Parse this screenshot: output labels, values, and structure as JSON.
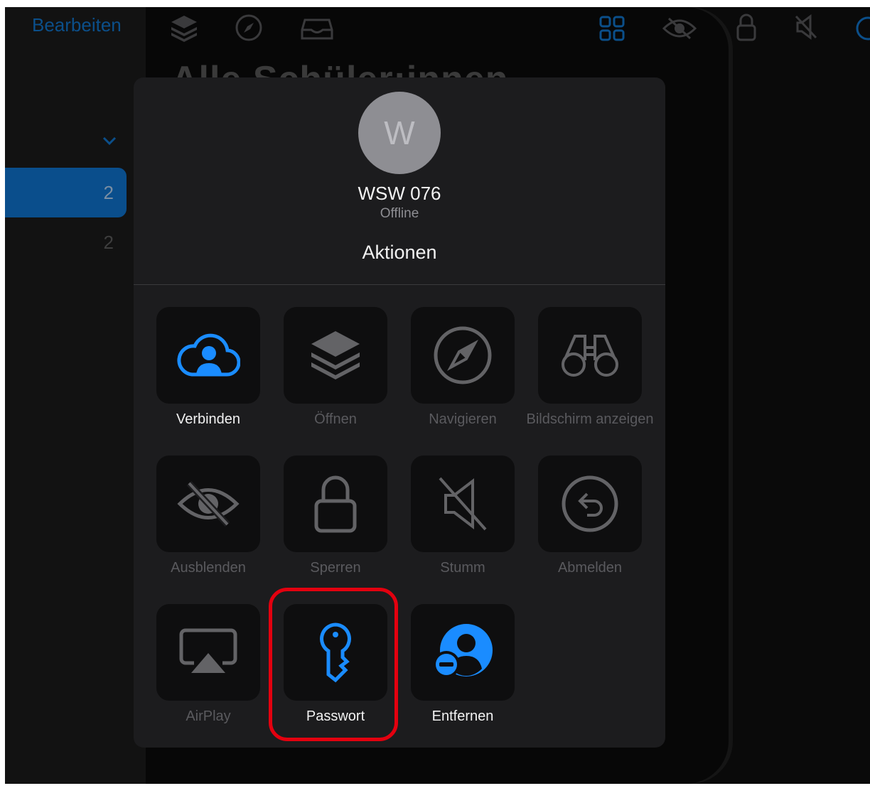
{
  "topbar": {
    "edit_label": "Bearbeiten",
    "icons": [
      "layers-icon",
      "compass-icon",
      "tray-icon",
      "grid-icon",
      "eye-slash-icon",
      "lock-icon",
      "speaker-mute-icon",
      "more-icon"
    ]
  },
  "background": {
    "title": "Alle Schüler:innen",
    "sidebar_counts": [
      "2",
      "2"
    ]
  },
  "popover": {
    "avatar_letter": "W",
    "device_name": "WSW 076",
    "status": "Offline",
    "section_title": "Aktionen",
    "actions": [
      {
        "label": "Verbinden",
        "enabled": true,
        "icon": "cloud-person-icon"
      },
      {
        "label": "Öffnen",
        "enabled": false,
        "icon": "layers-icon"
      },
      {
        "label": "Navigieren",
        "enabled": false,
        "icon": "compass-icon"
      },
      {
        "label": "Bildschirm anzeigen",
        "enabled": false,
        "icon": "binoculars-icon"
      },
      {
        "label": "Ausblenden",
        "enabled": false,
        "icon": "eye-slash-icon"
      },
      {
        "label": "Sperren",
        "enabled": false,
        "icon": "lock-icon"
      },
      {
        "label": "Stumm",
        "enabled": false,
        "icon": "speaker-mute-icon"
      },
      {
        "label": "Abmelden",
        "enabled": false,
        "icon": "logout-icon"
      },
      {
        "label": "AirPlay",
        "enabled": false,
        "icon": "airplay-icon"
      },
      {
        "label": "Passwort",
        "enabled": true,
        "icon": "key-icon"
      },
      {
        "label": "Entfernen",
        "enabled": true,
        "icon": "person-remove-icon"
      }
    ]
  },
  "colors": {
    "accent": "#1a8cff",
    "highlight": "#e3000f",
    "popover_bg": "#1c1c1e",
    "tile_bg": "#0e0e0f"
  }
}
